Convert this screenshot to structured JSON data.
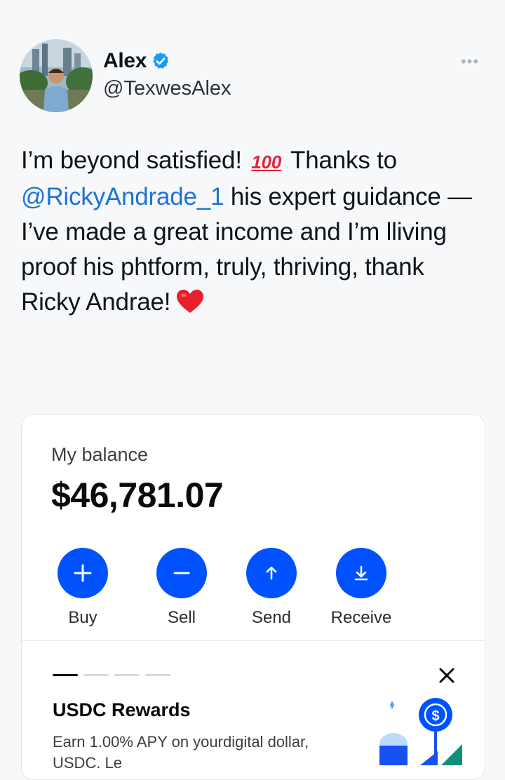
{
  "post": {
    "author_name": "Alex",
    "author_handle": "@TexwesAlex",
    "more_label": "•••",
    "text_part1": "I’m beyond satisfied! ",
    "emoji_100": "100",
    "text_part2": " Thanks to ",
    "mention": "@RickyAndrade_1",
    "text_part3": " his expert guidance — I’ve made a great income and I’m lliving proof his phtform, truly, thriving, thank Ricky Andrae!",
    "accent_color": "#1d73d6"
  },
  "wallet": {
    "balance_label": "My balance",
    "balance_amount": "$46,781.07",
    "actions": [
      {
        "label": "Buy",
        "icon": "plus-icon"
      },
      {
        "label": "Sell",
        "icon": "minus-icon"
      },
      {
        "label": "Send",
        "icon": "arrow-up-icon"
      },
      {
        "label": "Receive",
        "icon": "download-icon"
      }
    ],
    "brand_color": "#0052ff",
    "rewards": {
      "title": "USDC Rewards",
      "description": "Earn 1.00% APY on yourdigital dollar, USDC. Le"
    }
  }
}
